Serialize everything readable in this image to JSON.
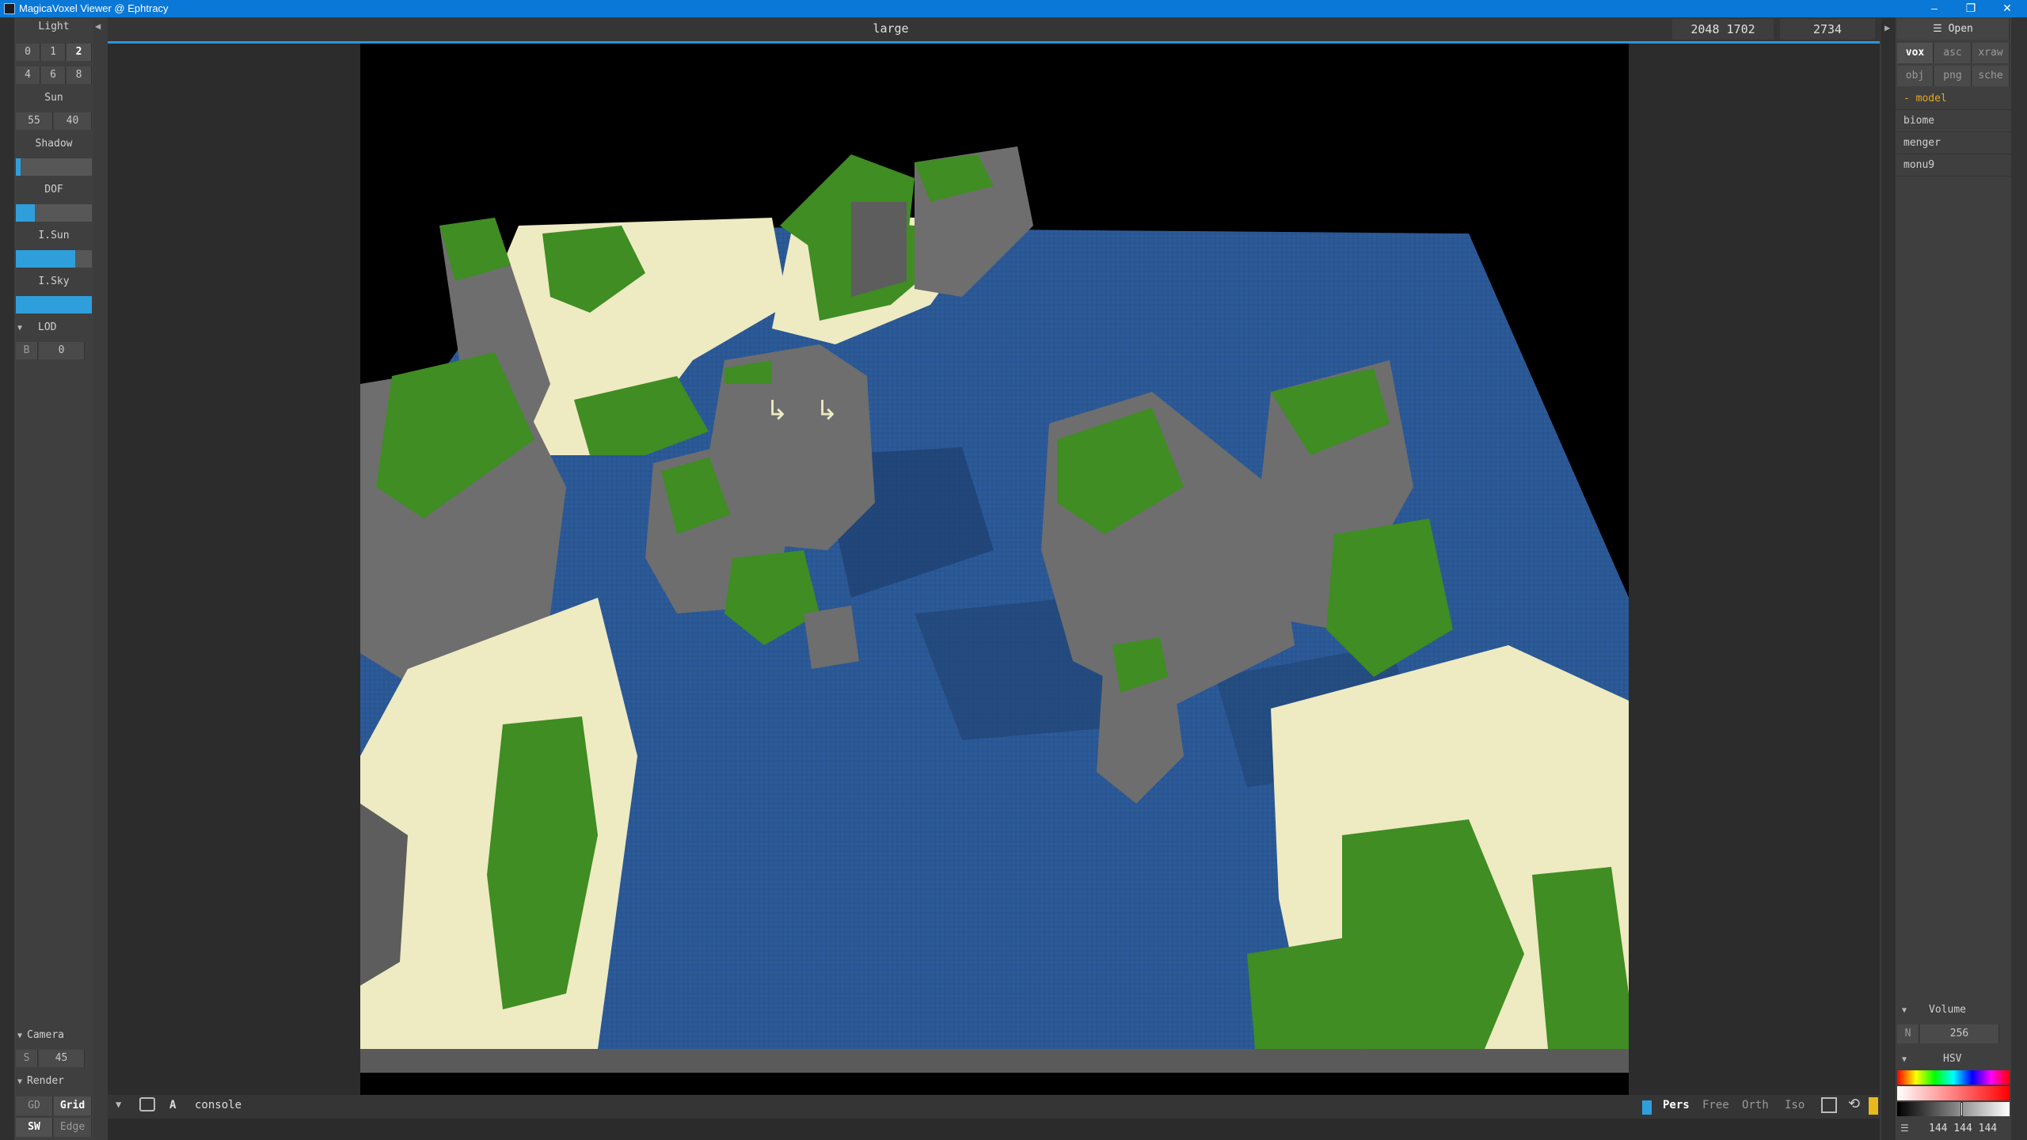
{
  "window": {
    "title": "MagicaVoxel Viewer @ Ephtracy",
    "controls": [
      "–",
      "❐",
      "✕"
    ]
  },
  "left_panel": {
    "light_label": "Light",
    "light_options": [
      "0",
      "1",
      "2",
      "4",
      "6",
      "8"
    ],
    "light_selected": "2",
    "sun_label": "Sun",
    "sun_values": [
      "55",
      "40"
    ],
    "shadow_label": "Shadow",
    "shadow_level": 0.06,
    "dof_label": "DOF",
    "dof_level": 0.25,
    "isun_label": "I.Sun",
    "isun_level": 0.78,
    "isky_label": "I.Sky",
    "isky_level": 1.0,
    "lod_label": "LOD",
    "lod_key": "B",
    "lod_value": "0",
    "camera_label": "Camera",
    "camera_key": "S",
    "camera_value": "45",
    "render_label": "Render",
    "render_options": [
      "GD",
      "Grid",
      "SW",
      "Edge"
    ]
  },
  "header": {
    "model_name": "large",
    "dimensions": "2048 1702",
    "size": "2734"
  },
  "bottom_bar": {
    "console_label": "console",
    "a_label": "A",
    "view_modes": [
      "Pers",
      "Free",
      "Orth",
      "Iso"
    ],
    "active_mode": "Pers"
  },
  "right_panel": {
    "open_label": "Open",
    "formats_row1": [
      "vox",
      "asc",
      "xraw"
    ],
    "formats_row2": [
      "obj",
      "png",
      "sche"
    ],
    "active_format": "vox",
    "folder_label": "- model",
    "files": [
      "biome",
      "menger",
      "monu9"
    ],
    "volume_label": "Volume",
    "volume_key": "N",
    "volume_value": "256",
    "hsv_label": "HSV",
    "color_value": "144 144 144"
  },
  "colors": {
    "accent": "#2a97d8",
    "water": "#2c5b9a",
    "grass": "#3f8d23",
    "sand": "#eeeac2",
    "rock": "#6e6e6e",
    "folder": "#e8a623"
  }
}
